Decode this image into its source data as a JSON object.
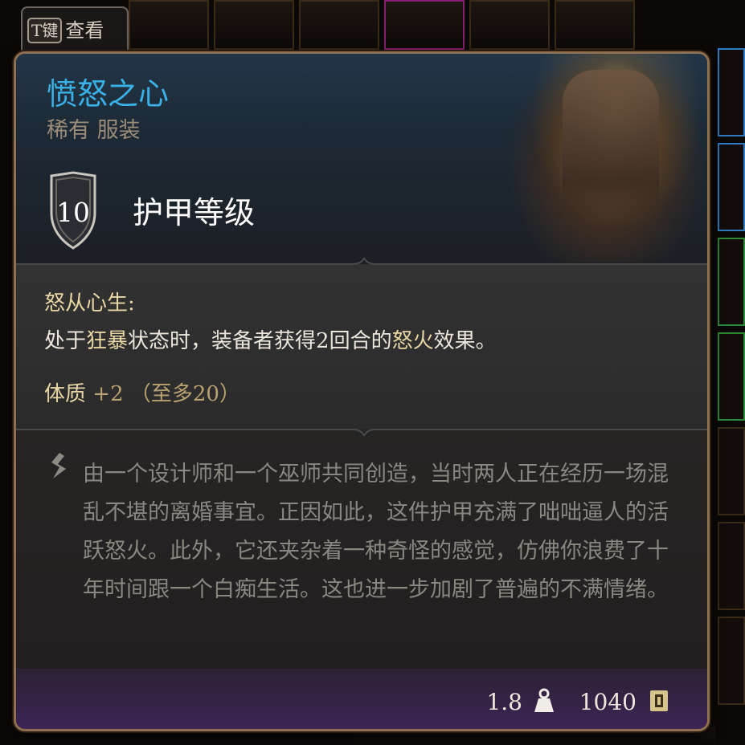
{
  "hotkey": {
    "key": "T键",
    "label": "查看"
  },
  "item": {
    "name": "愤怒之心",
    "rarity_type": "稀有 服装",
    "armor_class_value": "10",
    "armor_class_label": "护甲等级",
    "rarity_color": "#3ab1e6"
  },
  "effect": {
    "name": "怒从心生:",
    "desc_pre": "处于",
    "desc_hl1": "狂暴",
    "desc_mid": "状态时，装备者获得2回合的",
    "desc_hl2": "怒火",
    "desc_post": "效果。"
  },
  "stat": {
    "name": "体质",
    "value": "+2",
    "cap": "（至多20）"
  },
  "lore": {
    "text": "由一个设计师和一个巫师共同创造，当时两人正在经历一场混乱不堪的离婚事宜。正因如此，这件护甲充满了咄咄逼人的活跃怒火。此外，它还夹杂着一种奇怪的感觉，仿佛你浪费了十年时间跟一个白痴生活。这也进一步加剧了普遍的不满情绪。"
  },
  "footer": {
    "weight": "1.8",
    "weight_icon": "weight-icon",
    "value": "1040",
    "value_icon": "gold-coin-icon"
  }
}
